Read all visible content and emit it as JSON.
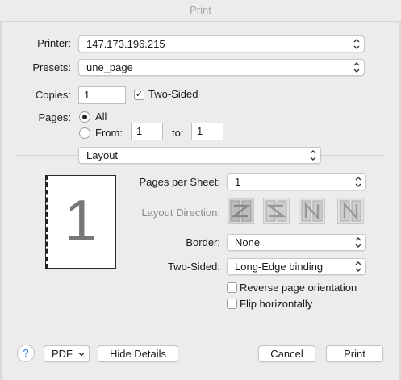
{
  "window": {
    "title": "Print"
  },
  "printer": {
    "label": "Printer:",
    "value": "147.173.196.215"
  },
  "presets": {
    "label": "Presets:",
    "value": "une_page"
  },
  "copies": {
    "label": "Copies:",
    "value": "1",
    "two_sided_label": "Two-Sided",
    "two_sided_checked": true
  },
  "pages": {
    "label": "Pages:",
    "all_label": "All",
    "from_label": "From:",
    "from_value": "1",
    "to_label": "to:",
    "to_value": "1",
    "selected": "All"
  },
  "section_popup": {
    "value": "Layout"
  },
  "preview": {
    "page_number": "1"
  },
  "layout": {
    "pages_per_sheet_label": "Pages per Sheet:",
    "pages_per_sheet_value": "1",
    "direction_label": "Layout Direction:",
    "direction_icons": [
      "layout-z-icon",
      "layout-reverse-z-icon",
      "layout-n-icon",
      "layout-reverse-n-icon"
    ],
    "border_label": "Border:",
    "border_value": "None",
    "two_sided_label": "Two-Sided:",
    "two_sided_value": "Long-Edge binding",
    "reverse_label": "Reverse page orientation",
    "reverse_checked": false,
    "flip_label": "Flip horizontally",
    "flip_checked": false
  },
  "footer": {
    "help": "?",
    "pdf": "PDF",
    "hide_details": "Hide Details",
    "cancel": "Cancel",
    "print": "Print"
  },
  "colors": {
    "accent": "#2a7de1",
    "background": "#ececec",
    "disabled_text": "#8a8a8a"
  }
}
